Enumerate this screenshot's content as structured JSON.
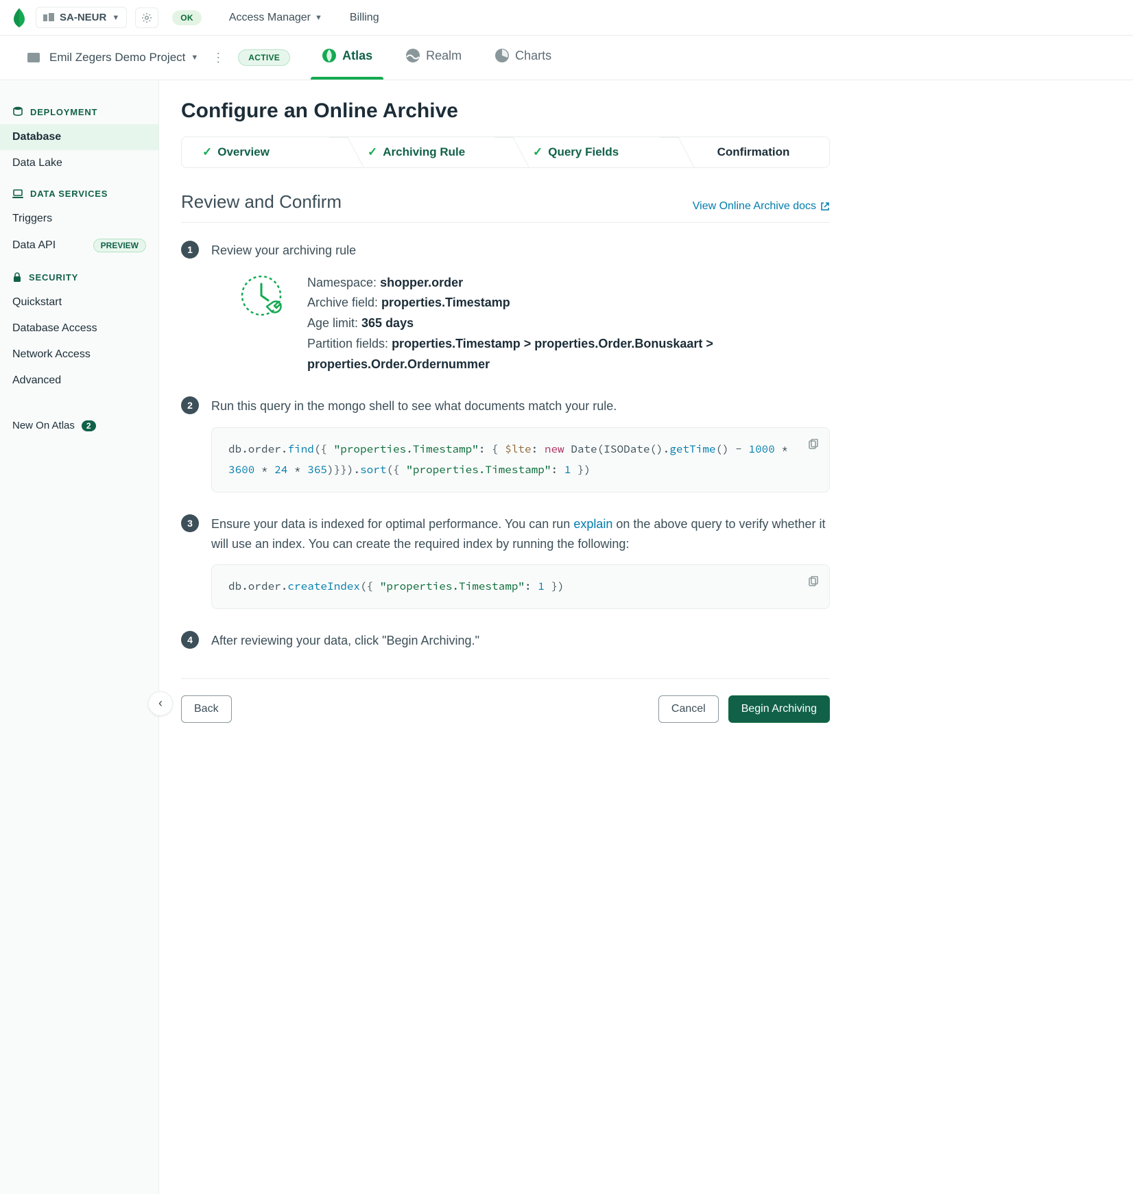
{
  "topnav": {
    "org_name": "SA-NEUR",
    "status_badge": "OK",
    "access_manager": "Access Manager",
    "billing": "Billing"
  },
  "projectbar": {
    "project_name": "Emil Zegers Demo Project",
    "active_badge": "ACTIVE",
    "tabs": [
      {
        "label": "Atlas",
        "active": true
      },
      {
        "label": "Realm",
        "active": false
      },
      {
        "label": "Charts",
        "active": false
      }
    ]
  },
  "sidebar": {
    "sections": [
      {
        "heading": "DEPLOYMENT",
        "items": [
          {
            "label": "Database",
            "active": true
          },
          {
            "label": "Data Lake"
          }
        ]
      },
      {
        "heading": "DATA SERVICES",
        "items": [
          {
            "label": "Triggers"
          },
          {
            "label": "Data API",
            "badge": "PREVIEW"
          }
        ]
      },
      {
        "heading": "SECURITY",
        "items": [
          {
            "label": "Quickstart"
          },
          {
            "label": "Database Access"
          },
          {
            "label": "Network Access"
          },
          {
            "label": "Advanced"
          }
        ]
      }
    ],
    "footer": {
      "label": "New On Atlas",
      "count": "2"
    }
  },
  "main": {
    "title": "Configure an Online Archive",
    "wizard": [
      "Overview",
      "Archiving Rule",
      "Query Fields",
      "Confirmation"
    ],
    "section_title": "Review and Confirm",
    "docs_link": "View Online Archive docs",
    "step1": {
      "title": "Review your archiving rule",
      "namespace_label": "Namespace: ",
      "namespace_value": "shopper.order",
      "archive_field_label": "Archive field: ",
      "archive_field_value": "properties.Timestamp",
      "age_limit_label": "Age limit: ",
      "age_limit_value": "365 days",
      "partition_label": "Partition fields: ",
      "partition_value": "properties.Timestamp > properties.Order.Bonuskaart > properties.Order.Ordernummer"
    },
    "step2": {
      "title": "Run this query in the mongo shell to see what documents match your rule."
    },
    "step3": {
      "pre": "Ensure your data is indexed for optimal performance. You can run ",
      "link": "explain",
      "post": " on the above query to verify whether it will use an index. You can create the required index by running the following:"
    },
    "step4": {
      "title": "After reviewing your data, click \"Begin Archiving.\""
    },
    "footer": {
      "back": "Back",
      "cancel": "Cancel",
      "begin": "Begin Archiving"
    }
  }
}
